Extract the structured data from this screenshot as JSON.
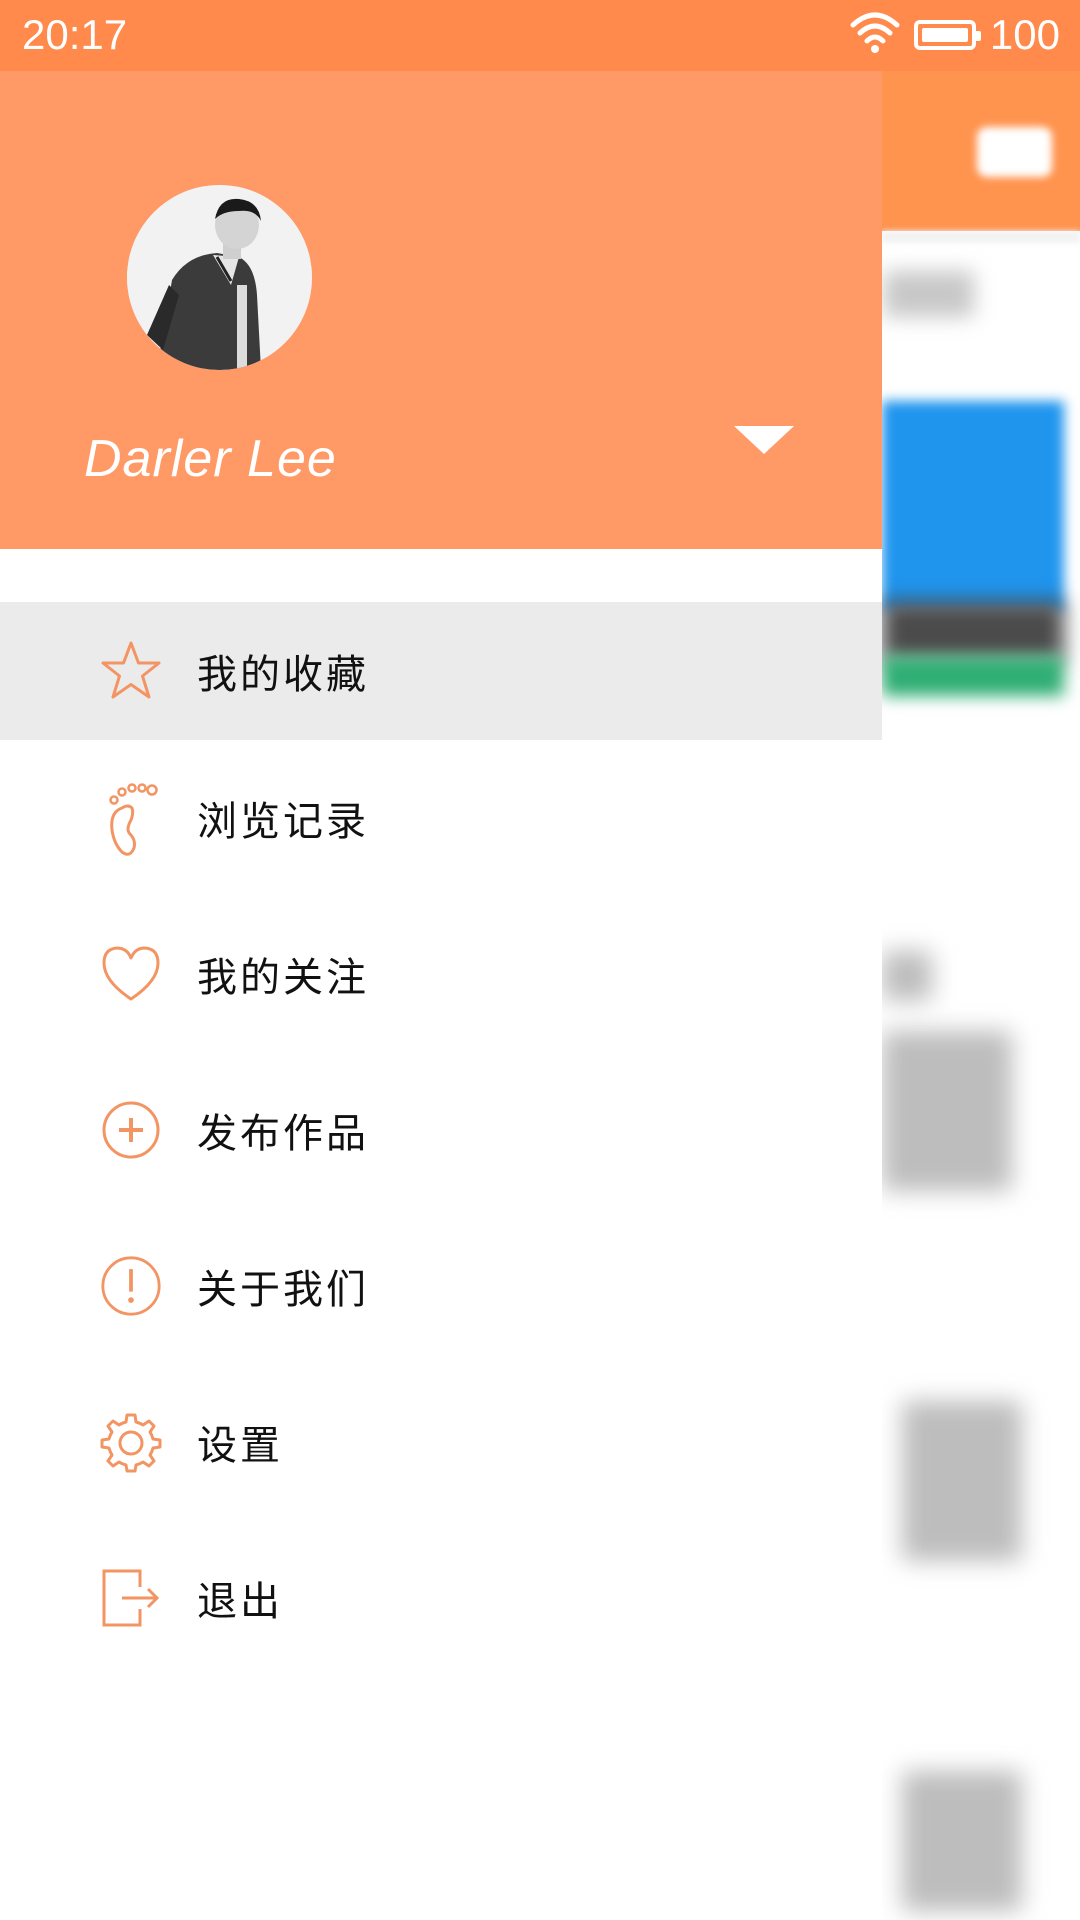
{
  "status_bar": {
    "time": "20:17",
    "battery_level": "100",
    "icons": [
      "wifi-icon",
      "battery-icon"
    ]
  },
  "drawer": {
    "user_name": "Darler Lee",
    "menu_items": [
      {
        "label": "我的收藏",
        "icon": "star-icon",
        "active": true
      },
      {
        "label": "浏览记录",
        "icon": "footprint-icon",
        "active": false
      },
      {
        "label": "我的关注",
        "icon": "heart-icon",
        "active": false
      },
      {
        "label": "发布作品",
        "icon": "plus-circle-icon",
        "active": false
      },
      {
        "label": "关于我们",
        "icon": "info-circle-icon",
        "active": false
      },
      {
        "label": "设置",
        "icon": "gear-icon",
        "active": false
      },
      {
        "label": "退出",
        "icon": "logout-icon",
        "active": false
      }
    ]
  },
  "colors": {
    "accent": "#ff9966",
    "status_bar": "#ff8a4c",
    "active_row": "#ebebeb",
    "icon_stroke": "#f39463"
  }
}
